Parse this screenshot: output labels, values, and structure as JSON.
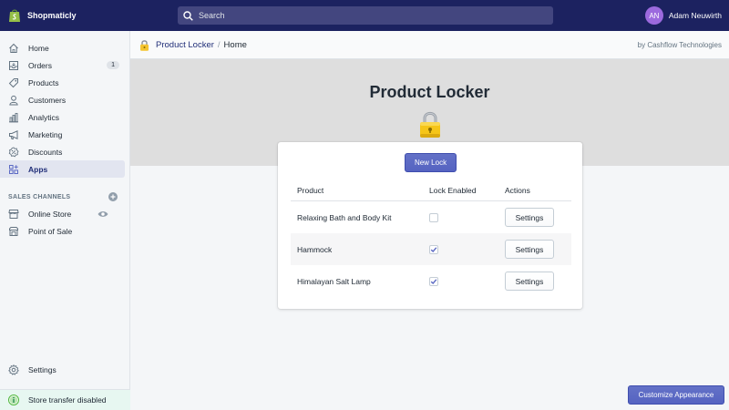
{
  "topbar": {
    "store_name": "Shopmaticly",
    "search_placeholder": "Search",
    "user_initials": "AN",
    "user_name": "Adam Neuwirth"
  },
  "sidebar": {
    "items": [
      {
        "label": "Home",
        "icon": "home-icon"
      },
      {
        "label": "Orders",
        "icon": "orders-icon",
        "badge": "1"
      },
      {
        "label": "Products",
        "icon": "tag-icon"
      },
      {
        "label": "Customers",
        "icon": "person-icon"
      },
      {
        "label": "Analytics",
        "icon": "bar-chart-icon"
      },
      {
        "label": "Marketing",
        "icon": "megaphone-icon"
      },
      {
        "label": "Discounts",
        "icon": "discount-icon"
      },
      {
        "label": "Apps",
        "icon": "apps-icon",
        "active": true
      }
    ],
    "sales_channels_heading": "SALES CHANNELS",
    "channels": [
      {
        "label": "Online Store",
        "icon": "store-icon"
      },
      {
        "label": "Point of Sale",
        "icon": "pos-icon"
      }
    ],
    "settings_label": "Settings",
    "store_transfer_label": "Store transfer disabled"
  },
  "breadcrumb": {
    "app_name": "Product Locker",
    "separator": "/",
    "page": "Home",
    "vendor": "by Cashflow Technologies"
  },
  "hero": {
    "title": "Product Locker"
  },
  "card": {
    "new_lock_label": "New Lock",
    "columns": [
      "Product",
      "Lock Enabled",
      "Actions"
    ],
    "rows": [
      {
        "product": "Relaxing Bath and Body Kit",
        "lock_enabled": false,
        "action": "Settings"
      },
      {
        "product": "Hammock",
        "lock_enabled": true,
        "action": "Settings"
      },
      {
        "product": "Himalayan Salt Lamp",
        "lock_enabled": true,
        "action": "Settings"
      }
    ]
  },
  "footer": {
    "customize_label": "Customize Appearance"
  },
  "colors": {
    "topbar": "#1c2260",
    "primary": "#5c6ac4",
    "active_nav": "#202e78",
    "hero_bg": "#dedede"
  }
}
